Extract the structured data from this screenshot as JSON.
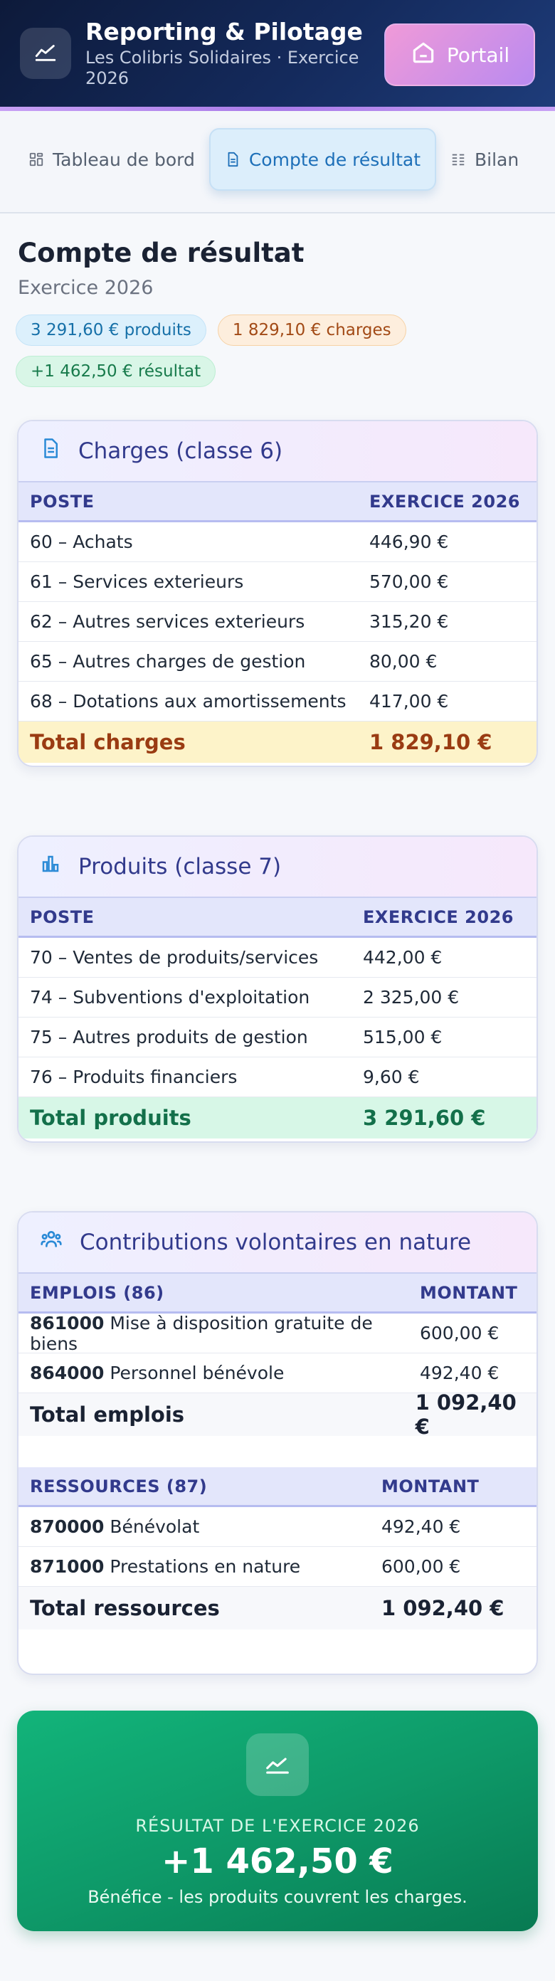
{
  "header": {
    "title": "Reporting & Pilotage",
    "subtitle": "Les Colibris Solidaires · Exercice 2026",
    "portal_label": "Portail",
    "logo_icon": "trend-line-icon",
    "portal_icon": "home-icon"
  },
  "tabs": [
    {
      "label": "Tableau de bord",
      "icon": "dashboard-icon",
      "active": false
    },
    {
      "label": "Compte de résultat",
      "icon": "document-icon",
      "active": true
    },
    {
      "label": "Bilan",
      "icon": "columns-icon",
      "active": false
    }
  ],
  "page": {
    "title": "Compte de résultat",
    "subtitle": "Exercice 2026",
    "badges": {
      "produits": "3 291,60 € produits",
      "charges": "1 829,10 € charges",
      "resultat": "+1 462,50 € résultat"
    }
  },
  "charges": {
    "title": "Charges (classe 6)",
    "col_poste": "POSTE",
    "col_exercice": "EXERCICE 2026",
    "rows": [
      {
        "poste": "60 – Achats",
        "montant": "446,90 €"
      },
      {
        "poste": "61 – Services exterieurs",
        "montant": "570,00 €"
      },
      {
        "poste": "62 – Autres services exterieurs",
        "montant": "315,20 €"
      },
      {
        "poste": "65 – Autres charges de gestion",
        "montant": "80,00 €"
      },
      {
        "poste": "68 – Dotations aux amortissements",
        "montant": "417,00 €"
      }
    ],
    "total_label": "Total charges",
    "total_value": "1 829,10 €"
  },
  "produits": {
    "title": "Produits (classe 7)",
    "col_poste": "POSTE",
    "col_exercice": "EXERCICE 2026",
    "rows": [
      {
        "poste": "70 – Ventes de produits/services",
        "montant": "442,00 €"
      },
      {
        "poste": "74 – Subventions d'exploitation",
        "montant": "2 325,00 €"
      },
      {
        "poste": "75 – Autres produits de gestion",
        "montant": "515,00 €"
      },
      {
        "poste": "76 – Produits financiers",
        "montant": "9,60 €"
      }
    ],
    "total_label": "Total produits",
    "total_value": "3 291,60 €"
  },
  "contributions": {
    "title": "Contributions volontaires en nature",
    "emplois": {
      "col_label": "EMPLOIS (86)",
      "col_montant": "MONTANT",
      "rows": [
        {
          "code": "861000",
          "label": "Mise à disposition gratuite de biens",
          "montant": "600,00 €"
        },
        {
          "code": "864000",
          "label": "Personnel bénévole",
          "montant": "492,40 €"
        }
      ],
      "total_label": "Total emplois",
      "total_value": "1 092,40 €"
    },
    "ressources": {
      "col_label": "RESSOURCES (87)",
      "col_montant": "MONTANT",
      "rows": [
        {
          "code": "870000",
          "label": "Bénévolat",
          "montant": "492,40 €"
        },
        {
          "code": "871000",
          "label": "Prestations en nature",
          "montant": "600,00 €"
        }
      ],
      "total_label": "Total ressources",
      "total_value": "1 092,40 €"
    }
  },
  "result": {
    "label": "RÉSULTAT DE L'EXERCICE 2026",
    "value": "+1 462,50 €",
    "note": "Bénéfice - les produits couvrent les charges."
  },
  "colors": {
    "header_bg": "#0d1a3a",
    "accent_purple": "#b98af0",
    "charges_total": "#9a3b12",
    "produits_total": "#13704a",
    "result_green": "#0e9a69"
  }
}
